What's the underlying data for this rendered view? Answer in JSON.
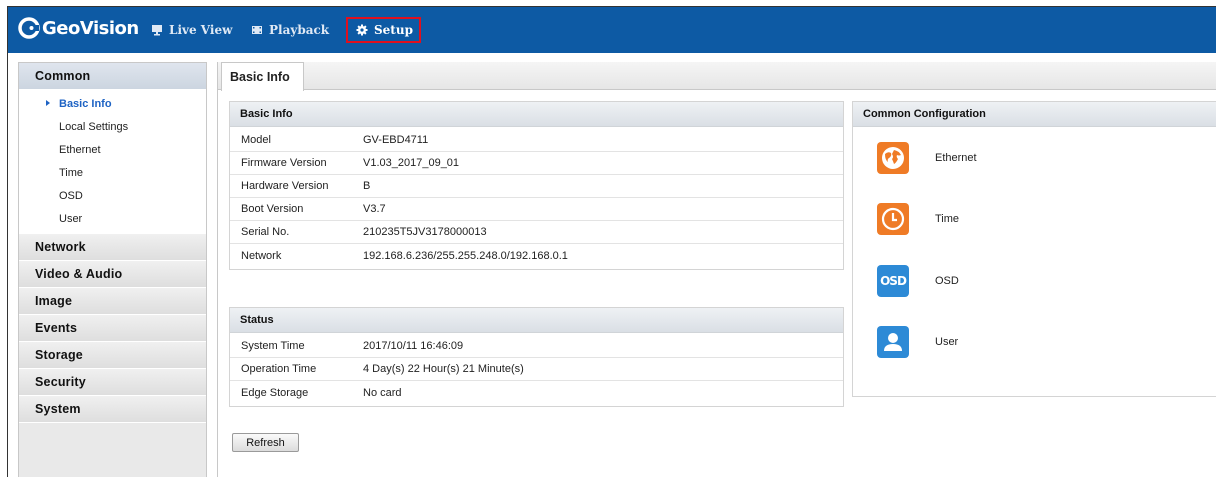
{
  "brand": {
    "logo_text": "GeoVision",
    "accent_color": "#0d5aa4",
    "highlight_color": "#e0101e"
  },
  "nav": {
    "live_view": {
      "label": "Live View",
      "icon": "monitor-icon"
    },
    "playback": {
      "label": "Playback",
      "icon": "film-icon"
    },
    "setup": {
      "label": "Setup",
      "icon": "gear-icon",
      "selected": true
    }
  },
  "sidebar": {
    "categories": [
      {
        "label": "Common",
        "active": true
      },
      {
        "label": "Network"
      },
      {
        "label": "Video & Audio"
      },
      {
        "label": "Image"
      },
      {
        "label": "Events"
      },
      {
        "label": "Storage"
      },
      {
        "label": "Security"
      },
      {
        "label": "System"
      }
    ],
    "common_items": [
      {
        "label": "Basic Info",
        "active": true
      },
      {
        "label": "Local Settings"
      },
      {
        "label": "Ethernet"
      },
      {
        "label": "Time"
      },
      {
        "label": "OSD"
      },
      {
        "label": "User"
      }
    ]
  },
  "main": {
    "tab": "Basic Info",
    "basic_info": {
      "title": "Basic Info",
      "rows": [
        {
          "key": "Model",
          "value": "GV-EBD4711"
        },
        {
          "key": "Firmware Version",
          "value": "V1.03_2017_09_01"
        },
        {
          "key": "Hardware Version",
          "value": "B"
        },
        {
          "key": "Boot Version",
          "value": "V3.7"
        },
        {
          "key": "Serial No.",
          "value": "210235T5JV3178000013"
        },
        {
          "key": "Network",
          "value": "192.168.6.236/255.255.248.0/192.168.0.1"
        }
      ]
    },
    "status": {
      "title": "Status",
      "rows": [
        {
          "key": "System Time",
          "value": "2017/10/11 16:46:09"
        },
        {
          "key": "Operation Time",
          "value": "4 Day(s) 22 Hour(s) 21 Minute(s)"
        },
        {
          "key": "Edge Storage",
          "value": "No card"
        }
      ]
    },
    "refresh_label": "Refresh",
    "common_config": {
      "title": "Common Configuration",
      "items": [
        {
          "label": "Ethernet",
          "icon": "globe-icon",
          "color": "#ef7b26"
        },
        {
          "label": "Time",
          "icon": "clock-icon",
          "color": "#ef7b26"
        },
        {
          "label": "OSD",
          "icon": "osd-icon",
          "color": "#2d8ad6",
          "icon_text": "OSD"
        },
        {
          "label": "User",
          "icon": "user-icon",
          "color": "#2d8ad6"
        }
      ]
    }
  }
}
